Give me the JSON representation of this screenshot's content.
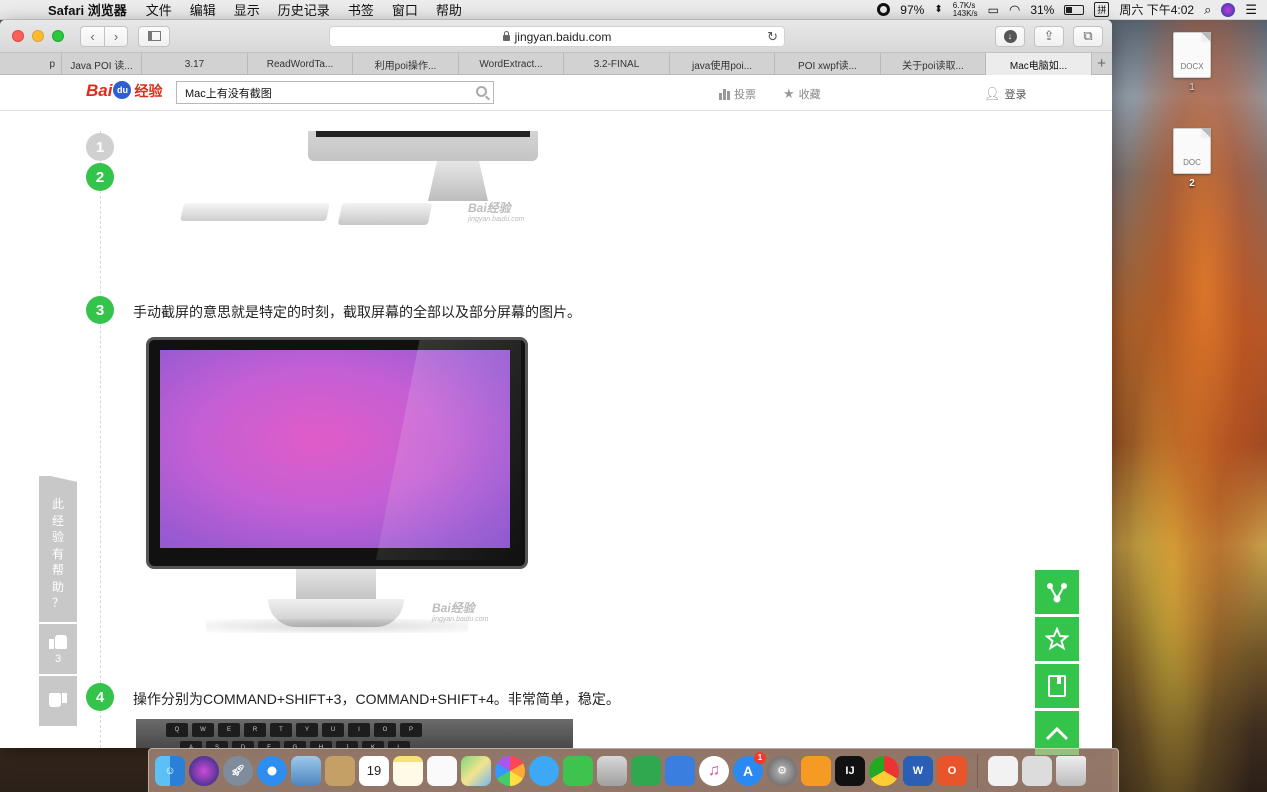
{
  "menubar": {
    "app_name": "Safari 浏览器",
    "menus": [
      "文件",
      "编辑",
      "显示",
      "历史记录",
      "书签",
      "窗口",
      "帮助"
    ],
    "status_percent": "97%",
    "net_up": "6.7K/s",
    "net_down": "143K/s",
    "battery": "31%",
    "clock": "周六 下午4:02"
  },
  "browser": {
    "url": "jingyan.baidu.com",
    "tabs": [
      "p",
      "Java POI 读...",
      "3.17",
      "ReadWordTa...",
      "利用poi操作...",
      "WordExtract...",
      "3.2-FINAL",
      "java使用poi...",
      "POI xwpf读...",
      "关于poi读取...",
      "Mac电脑如..."
    ]
  },
  "site": {
    "logo_text": "Bai",
    "logo_paw": "du",
    "logo_suffix": "经验",
    "search_value": "Mac上有没有截图",
    "vote_label": "投票",
    "fav_label": "收藏",
    "login_label": "登录"
  },
  "steps": [
    {
      "num": "1",
      "text": ""
    },
    {
      "num": "2",
      "text": ""
    },
    {
      "num": "3",
      "text": "手动截屏的意思就是特定的时刻，截取屏幕的全部以及部分屏幕的图片。"
    },
    {
      "num": "4",
      "text": "操作分别为COMMAND+SHIFT+3，COMMAND+SHIFT+4。非常简单，稳定。"
    }
  ],
  "watermark": "Bai经验",
  "watermark_url": "jingyan.baidu.com",
  "feedback": {
    "question_chars": [
      "此",
      "经",
      "验",
      "有",
      "帮",
      "助",
      "？"
    ],
    "like_count": "3"
  },
  "desktop": {
    "icons": [
      {
        "type": "DOCX",
        "label": "1"
      },
      {
        "type": "DOC",
        "label": "2"
      }
    ]
  },
  "dock": {
    "calendar_day": "19",
    "appstore_badge": "1"
  }
}
